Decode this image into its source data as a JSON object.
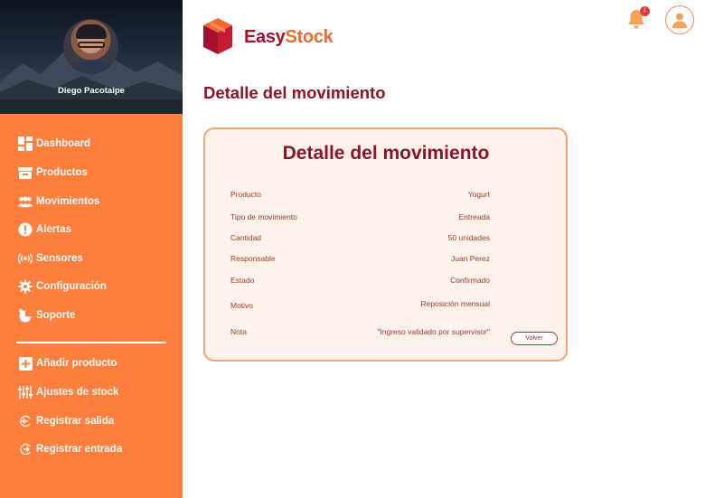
{
  "sidebar": {
    "user_name": "Diego Pacotaipe",
    "items": [
      {
        "label": "Dashboard",
        "icon": "dashboard-icon"
      },
      {
        "label": "Productos",
        "icon": "box-icon"
      },
      {
        "label": "Movimientos",
        "icon": "users-icon"
      },
      {
        "label": "Alertas",
        "icon": "alert-icon"
      },
      {
        "label": "Sensores",
        "icon": "sensor-icon"
      },
      {
        "label": "Configuración",
        "icon": "gear-icon"
      },
      {
        "label": "Soporte",
        "icon": "support-icon"
      }
    ],
    "actions": [
      {
        "label": "Añadir producto",
        "icon": "add-icon"
      },
      {
        "label": "Ajustes de stock",
        "icon": "sliders-icon"
      },
      {
        "label": "Registrar salida",
        "icon": "exit-icon"
      },
      {
        "label": "Registrar entrada",
        "icon": "entry-icon"
      }
    ]
  },
  "header": {
    "brand_easy": "Easy",
    "brand_stock": "Stock",
    "notification_count": "1"
  },
  "page": {
    "title": "Detalle del movimiento"
  },
  "card": {
    "title": "Detalle del movimiento",
    "rows": [
      {
        "label": "Producto",
        "value": "Yogurt"
      },
      {
        "label": "Tipo de movimiento",
        "value": "Entreada"
      },
      {
        "label": "Cantidad",
        "value": "50 unidades"
      },
      {
        "label": "Responsable",
        "value": "Juan Perez"
      },
      {
        "label": "Estado",
        "value": "Confirmado"
      },
      {
        "label": "Motivo",
        "value": "Reposición mensual"
      },
      {
        "label": "Nota",
        "value": "\"Ingreso validado por supervisor\""
      }
    ],
    "back_label": "Volver"
  },
  "colors": {
    "sidebar": "#fe7e3e",
    "brand_red": "#8e1328",
    "brand_orange": "#f06a2f",
    "card_bg": "#fef3ec",
    "card_border": "#f5a26f"
  }
}
